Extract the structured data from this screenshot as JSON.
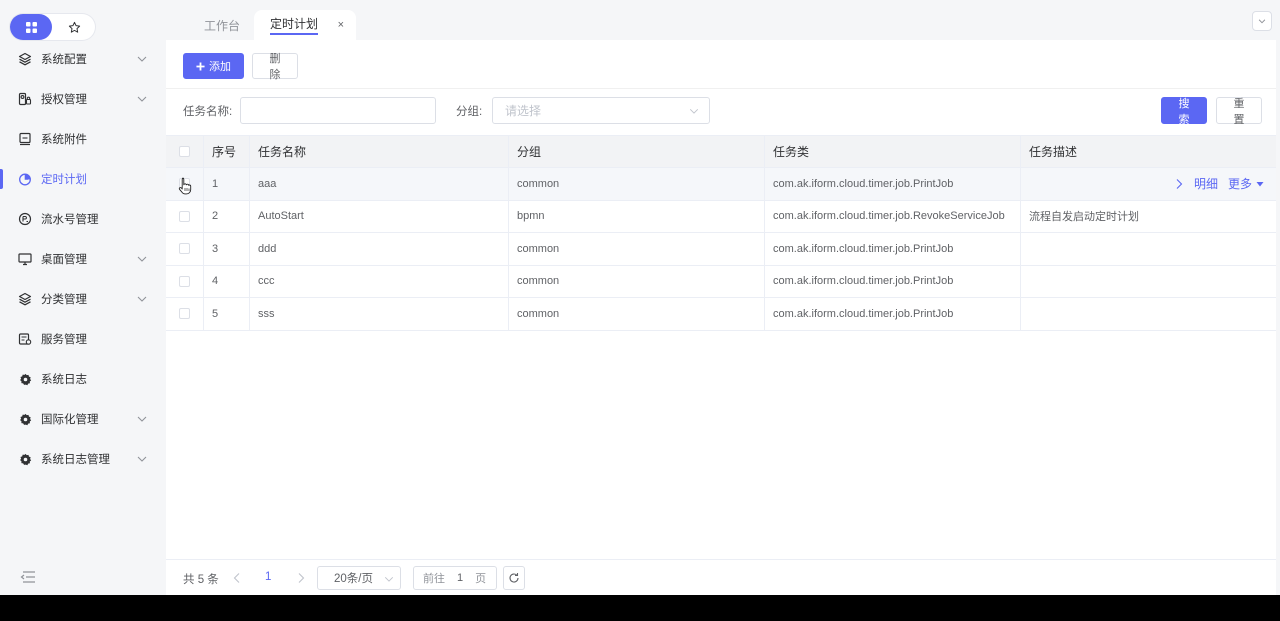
{
  "tabs": {
    "workbench": "工作台",
    "active": "定时计划",
    "close": "×"
  },
  "sidebar": {
    "items": [
      {
        "label": "系统配置",
        "icon": "layers-icon",
        "has_arrow": true
      },
      {
        "label": "授权管理",
        "icon": "user-lock-icon",
        "has_arrow": true
      },
      {
        "label": "系统附件",
        "icon": "attachment-icon",
        "has_arrow": false
      },
      {
        "label": "定时计划",
        "icon": "timer-icon",
        "has_arrow": false,
        "active": true
      },
      {
        "label": "流水号管理",
        "icon": "serial-icon",
        "has_arrow": false
      },
      {
        "label": "桌面管理",
        "icon": "monitor-icon",
        "has_arrow": true
      },
      {
        "label": "分类管理",
        "icon": "layers-icon",
        "has_arrow": true
      },
      {
        "label": "服务管理",
        "icon": "server-icon",
        "has_arrow": false
      },
      {
        "label": "系统日志",
        "icon": "gear-icon",
        "has_arrow": false
      },
      {
        "label": "国际化管理",
        "icon": "gear-icon",
        "has_arrow": true
      },
      {
        "label": "系统日志管理",
        "icon": "gear-icon",
        "has_arrow": true
      }
    ]
  },
  "toolbar": {
    "add_label": "添加",
    "delete_label": "删除"
  },
  "search": {
    "name_label": "任务名称:",
    "group_label": "分组:",
    "group_placeholder": "请选择",
    "search_label": "搜索",
    "reset_label": "重置"
  },
  "table": {
    "headers": [
      "序号",
      "任务名称",
      "分组",
      "任务类",
      "任务描述"
    ],
    "rows": [
      {
        "no": "1",
        "name": "aaa",
        "group": "common",
        "class": "com.ak.iform.cloud.timer.job.PrintJob",
        "desc": ""
      },
      {
        "no": "2",
        "name": "AutoStart",
        "group": "bpmn",
        "class": "com.ak.iform.cloud.timer.job.RevokeServiceJob",
        "desc": "流程自发启动定时计划"
      },
      {
        "no": "3",
        "name": "ddd",
        "group": "common",
        "class": "com.ak.iform.cloud.timer.job.PrintJob",
        "desc": ""
      },
      {
        "no": "4",
        "name": "ccc",
        "group": "common",
        "class": "com.ak.iform.cloud.timer.job.PrintJob",
        "desc": ""
      },
      {
        "no": "5",
        "name": "sss",
        "group": "common",
        "class": "com.ak.iform.cloud.timer.job.PrintJob",
        "desc": ""
      }
    ],
    "row_actions": {
      "detail": "明细",
      "more": "更多"
    }
  },
  "pager": {
    "total": "共 5 条",
    "current_page": "1",
    "page_size": "20条/页",
    "goto_prefix": "前往",
    "goto_value": "1",
    "goto_suffix": "页"
  },
  "colors": {
    "accent": "#5b67f3"
  }
}
